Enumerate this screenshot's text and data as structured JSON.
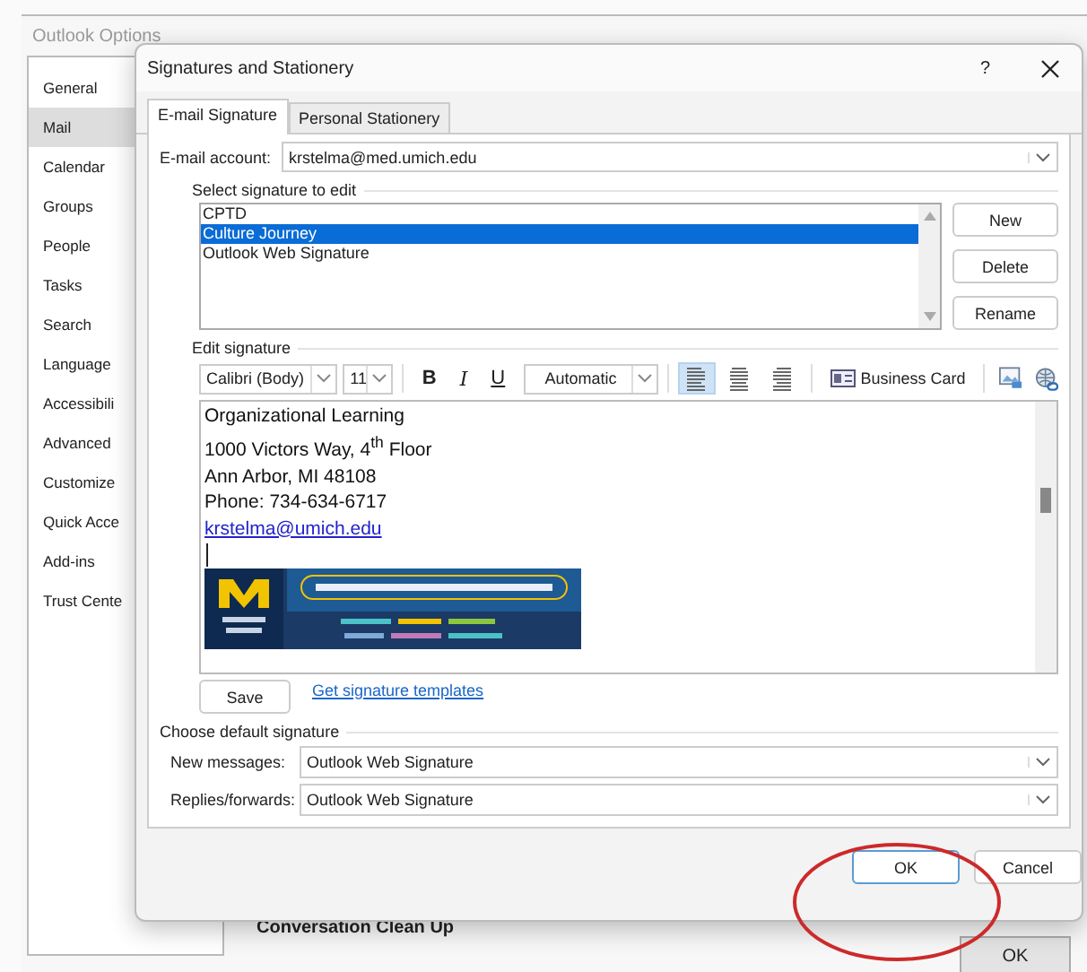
{
  "background_window": {
    "title": "Outlook Options",
    "sidebar": [
      {
        "label": "General",
        "selected": false
      },
      {
        "label": "Mail",
        "selected": true
      },
      {
        "label": "Calendar",
        "selected": false
      },
      {
        "label": "Groups",
        "selected": false
      },
      {
        "label": "People",
        "selected": false
      },
      {
        "label": "Tasks",
        "selected": false
      },
      {
        "label": "Search",
        "selected": false
      },
      {
        "label": "Language",
        "selected": false
      },
      {
        "label": "Accessibili",
        "selected": false
      },
      {
        "label": "Advanced",
        "selected": false
      },
      {
        "label": "Customize",
        "selected": false
      },
      {
        "label": "Quick Acce",
        "selected": false
      },
      {
        "label": "Add-ins",
        "selected": false
      },
      {
        "label": "Trust Cente",
        "selected": false
      }
    ],
    "section_heading": "Conversation Clean Up",
    "ok_button": "OK"
  },
  "dialog": {
    "title": "Signatures and Stationery",
    "help": "?",
    "tabs": [
      {
        "label": "E-mail Signature",
        "selected": true
      },
      {
        "label": "Personal Stationery",
        "selected": false
      }
    ],
    "account": {
      "label": "E-mail account:",
      "value": "krstelma@med.umich.edu"
    },
    "select_heading": "Select signature to edit",
    "signatures": [
      {
        "name": "CPTD",
        "selected": false
      },
      {
        "name": "Culture Journey",
        "selected": true
      },
      {
        "name": "Outlook Web Signature",
        "selected": false
      }
    ],
    "side_buttons": [
      "New",
      "Delete",
      "Rename"
    ],
    "edit_heading": "Edit signature",
    "toolbar": {
      "font": "Calibri (Body)",
      "size": "11",
      "bold": "B",
      "italic": "I",
      "underline": "U",
      "color_setting": "Automatic",
      "align": [
        {
          "kind": "left",
          "selected": true
        },
        {
          "kind": "center",
          "selected": false
        },
        {
          "kind": "right",
          "selected": false
        }
      ],
      "business_card": "Business Card"
    },
    "signature_lines": [
      {
        "kind": "text",
        "text": "Organizational Learning"
      },
      {
        "kind": "text",
        "text": "1000 Victors Way, 4$^{th}$ Floor"
      },
      {
        "kind": "text",
        "text": "Ann Arbor, MI 48108"
      },
      {
        "kind": "text",
        "text": "Phone: 734-634-6717"
      },
      {
        "kind": "link",
        "text": "krstelma@umich.edu"
      }
    ],
    "save_button": "Save",
    "templates_link": "Get signature templates",
    "defaults_heading": "Choose default signature",
    "defaults": [
      {
        "label": "New messages:",
        "value": "Outlook Web Signature"
      },
      {
        "label": "Replies/forwards:",
        "value": "Outlook Web Signature"
      }
    ],
    "buttons": [
      {
        "label": "OK",
        "default": true
      },
      {
        "label": "Cancel",
        "default": false
      }
    ]
  }
}
